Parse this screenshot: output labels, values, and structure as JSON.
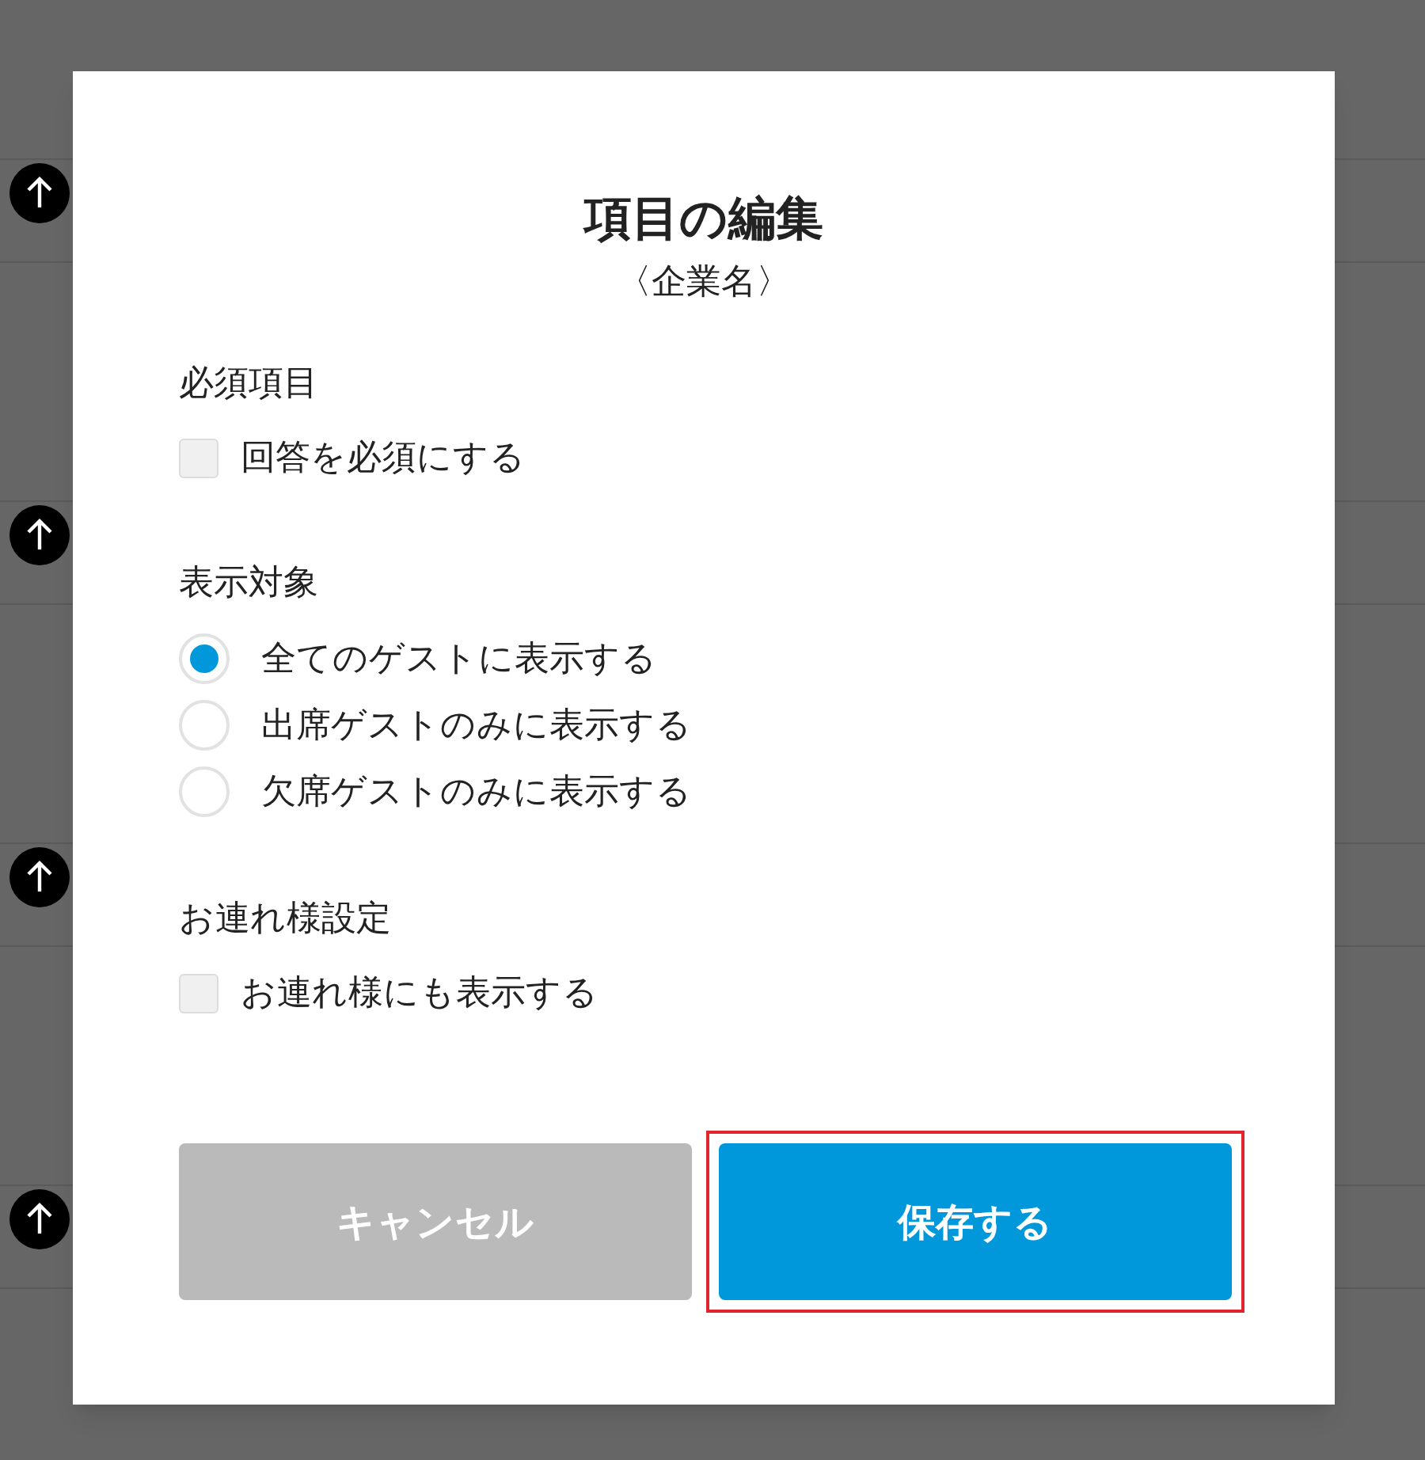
{
  "dialog": {
    "title": "項目の編集",
    "subtitle": "〈企業名〉",
    "sections": [
      {
        "label": "必須項目",
        "kind": "checkbox",
        "options": [
          {
            "label": "回答を必須にする",
            "checked": false
          }
        ]
      },
      {
        "label": "表示対象",
        "kind": "radio",
        "options": [
          {
            "label": "全てのゲストに表示する",
            "selected": true
          },
          {
            "label": "出席ゲストのみに表示する",
            "selected": false
          },
          {
            "label": "欠席ゲストのみに表示する",
            "selected": false
          }
        ]
      },
      {
        "label": "お連れ様設定",
        "kind": "checkbox",
        "options": [
          {
            "label": "お連れ様にも表示する",
            "checked": false
          }
        ]
      }
    ],
    "buttons": [
      {
        "label": "キャンセル",
        "kind": "cancel",
        "highlighted": false
      },
      {
        "label": "保存する",
        "kind": "primary",
        "highlighted": true
      }
    ]
  }
}
